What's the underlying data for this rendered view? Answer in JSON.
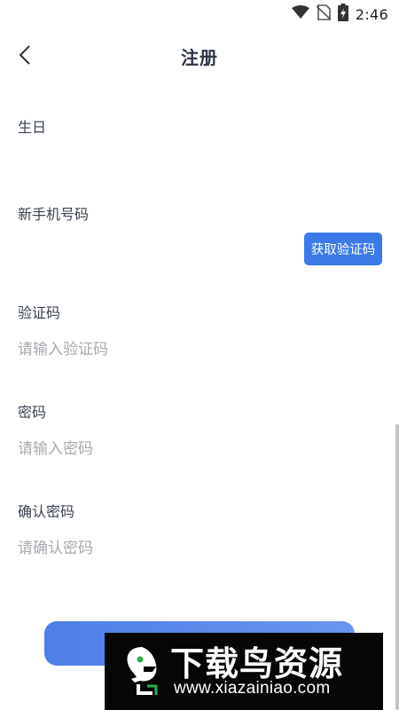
{
  "status_bar": {
    "time": "2:46"
  },
  "header": {
    "title": "注册"
  },
  "form": {
    "birthday": {
      "label": "生日",
      "value": ""
    },
    "phone": {
      "label": "新手机号码",
      "value": ""
    },
    "get_code_button": "获取验证码",
    "code": {
      "label": "验证码",
      "placeholder": "请输入验证码"
    },
    "password": {
      "label": "密码",
      "placeholder": "请输入密码"
    },
    "confirm_password": {
      "label": "确认密码",
      "placeholder": "请确认密码"
    }
  },
  "watermark": {
    "title": "下载鸟资源",
    "url": "www.xiazainiao.com"
  },
  "colors": {
    "accent": "#3d7ae8",
    "title": "#2b3444",
    "placeholder": "#a6a9ae"
  }
}
